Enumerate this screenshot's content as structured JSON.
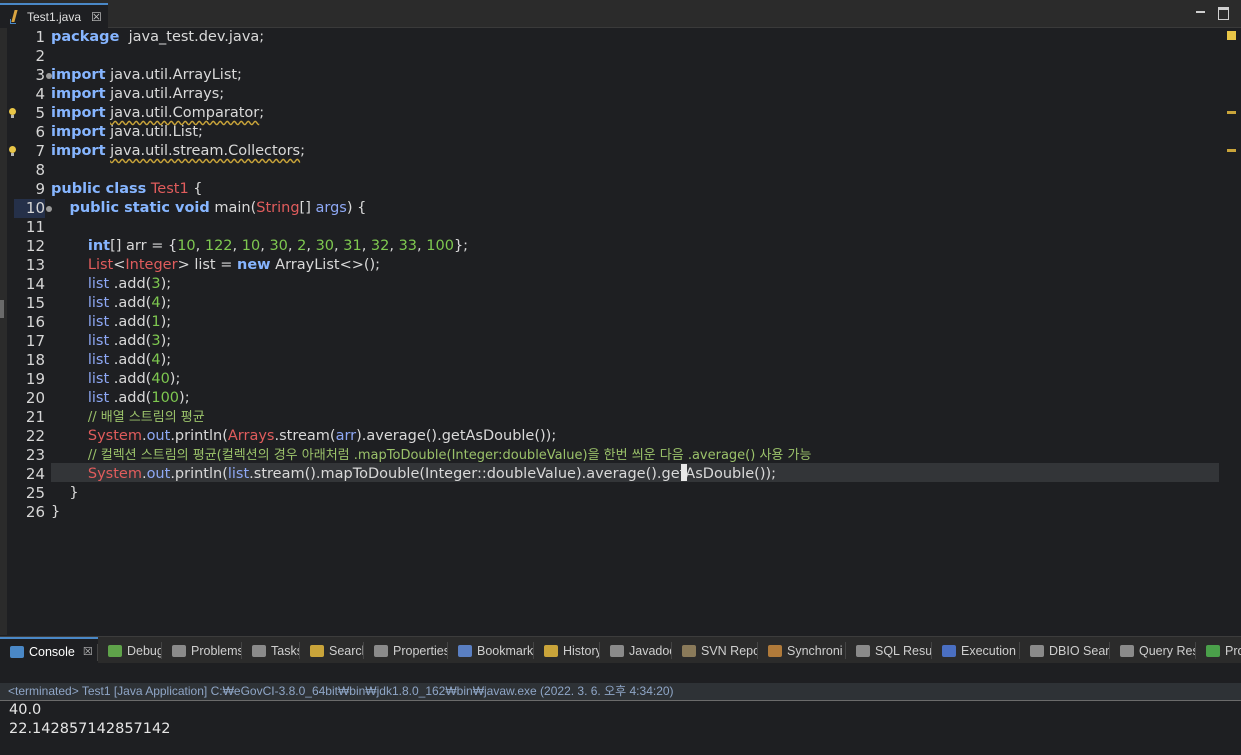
{
  "editor": {
    "tab_label": "Test1.java",
    "tab_close": "☒",
    "lines": [
      {
        "n": "1",
        "tokens": [
          [
            "kw",
            "package"
          ],
          [
            "",
            "  java_test.dev.java;"
          ]
        ]
      },
      {
        "n": "2",
        "tokens": []
      },
      {
        "n": "3",
        "fold": true,
        "tokens": [
          [
            "kw",
            "import"
          ],
          [
            "",
            " java.util.ArrayList;"
          ]
        ]
      },
      {
        "n": "4",
        "tokens": [
          [
            "kw",
            "import"
          ],
          [
            "",
            " java.util.Arrays;"
          ]
        ]
      },
      {
        "n": "5",
        "bulb": true,
        "tokens": [
          [
            "kw",
            "import"
          ],
          [
            "",
            " "
          ],
          [
            "warn",
            "java.util.Comparator"
          ],
          [
            "",
            ";"
          ]
        ]
      },
      {
        "n": "6",
        "tokens": [
          [
            "kw",
            "import"
          ],
          [
            "",
            " java.util.List;"
          ]
        ]
      },
      {
        "n": "7",
        "bulb": true,
        "tokens": [
          [
            "kw",
            "import"
          ],
          [
            "",
            " "
          ],
          [
            "warn",
            "java.util.stream.Collectors"
          ],
          [
            "",
            ";"
          ]
        ]
      },
      {
        "n": "8",
        "tokens": []
      },
      {
        "n": "9",
        "tokens": [
          [
            "kw",
            "public class"
          ],
          [
            "",
            " "
          ],
          [
            "cls",
            "Test1"
          ],
          [
            "",
            " {"
          ]
        ]
      },
      {
        "n": "10",
        "fold": true,
        "gutter_hl": true,
        "tokens": [
          [
            "",
            "    "
          ],
          [
            "kw",
            "public static void"
          ],
          [
            "",
            " main("
          ],
          [
            "cls",
            "String"
          ],
          [
            "",
            "[] "
          ],
          [
            "var",
            "args"
          ],
          [
            "",
            ") {"
          ]
        ]
      },
      {
        "n": "11",
        "tokens": []
      },
      {
        "n": "12",
        "tokens": [
          [
            "",
            "        "
          ],
          [
            "kw",
            "int"
          ],
          [
            "",
            "[] arr = {"
          ],
          [
            "num",
            "10"
          ],
          [
            "",
            ", "
          ],
          [
            "num",
            "122"
          ],
          [
            "",
            ", "
          ],
          [
            "num",
            "10"
          ],
          [
            "",
            ", "
          ],
          [
            "num",
            "30"
          ],
          [
            "",
            ", "
          ],
          [
            "num",
            "2"
          ],
          [
            "",
            ", "
          ],
          [
            "num",
            "30"
          ],
          [
            "",
            ", "
          ],
          [
            "num",
            "31"
          ],
          [
            "",
            ", "
          ],
          [
            "num",
            "32"
          ],
          [
            "",
            ", "
          ],
          [
            "num",
            "33"
          ],
          [
            "",
            ", "
          ],
          [
            "num",
            "100"
          ],
          [
            "",
            "};"
          ]
        ]
      },
      {
        "n": "13",
        "tokens": [
          [
            "",
            "        "
          ],
          [
            "cls",
            "List"
          ],
          [
            "",
            "<"
          ],
          [
            "cls",
            "Integer"
          ],
          [
            "",
            "> list = "
          ],
          [
            "kw",
            "new"
          ],
          [
            "",
            " ArrayList<>();"
          ]
        ]
      },
      {
        "n": "14",
        "tokens": [
          [
            "",
            "        "
          ],
          [
            "var",
            "list"
          ],
          [
            "",
            " .add("
          ],
          [
            "num",
            "3"
          ],
          [
            "",
            "); "
          ]
        ]
      },
      {
        "n": "15",
        "tokens": [
          [
            "",
            "        "
          ],
          [
            "var",
            "list"
          ],
          [
            "",
            " .add("
          ],
          [
            "num",
            "4"
          ],
          [
            "",
            ");"
          ]
        ]
      },
      {
        "n": "16",
        "tokens": [
          [
            "",
            "        "
          ],
          [
            "var",
            "list"
          ],
          [
            "",
            " .add("
          ],
          [
            "num",
            "1"
          ],
          [
            "",
            ");"
          ]
        ]
      },
      {
        "n": "17",
        "tokens": [
          [
            "",
            "        "
          ],
          [
            "var",
            "list"
          ],
          [
            "",
            " .add("
          ],
          [
            "num",
            "3"
          ],
          [
            "",
            ");"
          ]
        ]
      },
      {
        "n": "18",
        "tokens": [
          [
            "",
            "        "
          ],
          [
            "var",
            "list"
          ],
          [
            "",
            " .add("
          ],
          [
            "num",
            "4"
          ],
          [
            "",
            ");"
          ]
        ]
      },
      {
        "n": "19",
        "tokens": [
          [
            "",
            "        "
          ],
          [
            "var",
            "list"
          ],
          [
            "",
            " .add("
          ],
          [
            "num",
            "40"
          ],
          [
            "",
            ");"
          ]
        ]
      },
      {
        "n": "20",
        "tokens": [
          [
            "",
            "        "
          ],
          [
            "var",
            "list"
          ],
          [
            "",
            " .add("
          ],
          [
            "num",
            "100"
          ],
          [
            "",
            ");"
          ]
        ]
      },
      {
        "n": "21",
        "tokens": [
          [
            "",
            "        "
          ],
          [
            "cmt",
            "// 배열 스트림의 평균"
          ]
        ]
      },
      {
        "n": "22",
        "tokens": [
          [
            "",
            "        "
          ],
          [
            "cls",
            "System"
          ],
          [
            "",
            "."
          ],
          [
            "fld",
            "out"
          ],
          [
            "",
            ".println("
          ],
          [
            "cls",
            "Arrays"
          ],
          [
            "",
            ".stream("
          ],
          [
            "var",
            "arr"
          ],
          [
            "",
            ").average().getAsDouble());"
          ]
        ]
      },
      {
        "n": "23",
        "tokens": [
          [
            "",
            "        "
          ],
          [
            "cmt",
            "// 컬렉션 스트림의 평균(컬렉션의 경우 아래처럼 .mapToDouble(Integer:doubleValue)을 한번 씌운 다음 .average() 사용 가능"
          ]
        ]
      },
      {
        "n": "24",
        "current": true,
        "tokens": [
          [
            "",
            "        "
          ],
          [
            "cls",
            "System"
          ],
          [
            "",
            "."
          ],
          [
            "fld",
            "out"
          ],
          [
            "",
            ".println("
          ],
          [
            "var",
            "list"
          ],
          [
            "",
            ".stream().mapToDouble(Integer::doubleValue).average()"
          ],
          [
            "caret",
            "."
          ],
          [
            "",
            "getAsDouble());"
          ]
        ]
      },
      {
        "n": "25",
        "tokens": [
          [
            "",
            "    }"
          ]
        ]
      },
      {
        "n": "26",
        "tokens": [
          [
            "",
            "}"
          ]
        ]
      }
    ]
  },
  "views": {
    "tabs": [
      {
        "label": "Console",
        "icon_color": "#4a88c7",
        "icon": "console-icon",
        "active": true,
        "close": "☒"
      },
      {
        "label": "Debug",
        "icon_color": "#5fa34a",
        "icon": "bug-icon"
      },
      {
        "label": "Problems",
        "icon_color": "#8a8a8a",
        "icon": "problems-icon"
      },
      {
        "label": "Tasks",
        "icon_color": "#8a8a8a",
        "icon": "tasks-icon"
      },
      {
        "label": "Search",
        "icon_color": "#c9a43a",
        "icon": "search-icon"
      },
      {
        "label": "Properties",
        "icon_color": "#8a8a8a",
        "icon": "properties-icon"
      },
      {
        "label": "Bookmarks",
        "icon_color": "#5a7fc2",
        "icon": "bookmark-icon"
      },
      {
        "label": "History",
        "icon_color": "#c9a43a",
        "icon": "history-icon"
      },
      {
        "label": "Javadoc",
        "icon_color": "#8a8a8a",
        "icon": "at-icon"
      },
      {
        "label": "SVN Repo",
        "icon_color": "#8a7a5a",
        "icon": "svn-icon"
      },
      {
        "label": "Synchroni",
        "icon_color": "#b07a3a",
        "icon": "sync-icon"
      },
      {
        "label": "SQL Result",
        "icon_color": "#8a8a8a",
        "icon": "grid-icon"
      },
      {
        "label": "Execution",
        "icon_color": "#4a6fc2",
        "icon": "execution-icon"
      },
      {
        "label": "DBIO Searc",
        "icon_color": "#8a8a8a",
        "icon": "dbio-search-icon"
      },
      {
        "label": "Query Resu",
        "icon_color": "#8a8a8a",
        "icon": "grid-icon"
      },
      {
        "label": "Prog",
        "icon_color": "#4aa04a",
        "icon": "progress-icon"
      }
    ]
  },
  "console": {
    "status": "<terminated> Test1 [Java Application] C:₩eGovCI-3.8.0_64bit₩bin₩jdk1.8.0_162₩bin₩javaw.exe  (2022. 3. 6. 오후 4:34:20)",
    "output": [
      "40.0",
      "22.142857142857142"
    ]
  }
}
